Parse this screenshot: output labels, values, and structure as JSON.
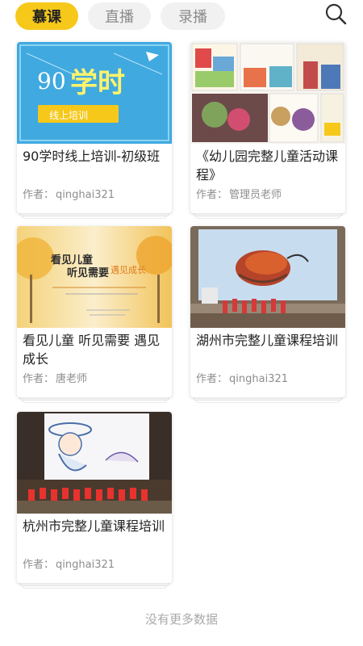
{
  "tabs": [
    {
      "label": "慕课",
      "active": true
    },
    {
      "label": "直播",
      "active": false
    },
    {
      "label": "录播",
      "active": false
    }
  ],
  "search": {
    "icon": "search-icon"
  },
  "author_prefix": "作者：",
  "courses": [
    {
      "title": "90学时线上培训-初级班",
      "author": "qinghai321",
      "thumb_text": [
        "90",
        "学时",
        "线上培训"
      ]
    },
    {
      "title": "《幼儿园完整儿童活动课程》",
      "author": "管理员老师"
    },
    {
      "title": "看见儿童 听见需要 遇见成长",
      "author": "唐老师",
      "thumb_text": [
        "看见儿童",
        "听见需要",
        "遇见成长"
      ]
    },
    {
      "title": "湖州市完整儿童课程培训",
      "author": "qinghai321"
    },
    {
      "title": "杭州市完整儿童课程培训",
      "author": "qinghai321"
    }
  ],
  "footer": "没有更多数据",
  "colors": {
    "accent": "#f6c81a",
    "thumb_blue": "#40a9e0"
  }
}
